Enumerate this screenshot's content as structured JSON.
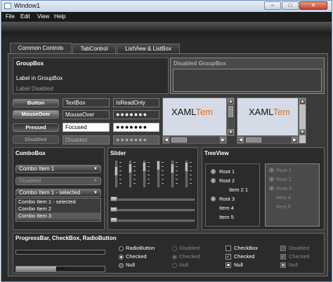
{
  "window": {
    "title": "Window1",
    "min": "–",
    "max": "□",
    "close": "✕"
  },
  "menu": [
    "File",
    "Edit",
    "View",
    "Help"
  ],
  "tabs": [
    "Common Controls",
    "TabControl",
    "ListView & ListBox"
  ],
  "groupbox": {
    "header": "GroupBox",
    "label": "Label in GroupBox",
    "label_disabled": "Label Disabled",
    "disabled_header": "Disabled GroupBox"
  },
  "buttons": [
    "Button",
    "MouseOver",
    "Pressed",
    "Disabled"
  ],
  "textboxes": [
    "TextBox",
    "MouseOver",
    "Focused",
    "Disabled"
  ],
  "passwords": {
    "readonly": "IsReadOnly",
    "p1": "●●●●●●●",
    "p2": "●●●●●●●",
    "p3": "●●●●●●●"
  },
  "xaml": {
    "prefix": "XAML",
    "suffix": "Tem"
  },
  "combobox": {
    "header": "ComboBox",
    "c1": "Combo Item 1",
    "c2": "Disabled",
    "c3": "Combo Item 1 - selected",
    "list": [
      "Combo Item 1 - selected",
      "Combo Item 2",
      "Combo Item 3"
    ]
  },
  "slider": {
    "header": "Slider"
  },
  "treeview": {
    "header": "TreeView",
    "items": [
      "Root 1",
      "Root 2",
      "Item 2 1",
      "Root 3",
      "Item 4",
      "Item 5"
    ],
    "dis_items": [
      "Root 1",
      "Root 2",
      "Root 3",
      "Item 4",
      "Item 5"
    ]
  },
  "progress": {
    "header": "ProgressBar, CheckBox, RadioButton",
    "value_label": "45%",
    "value": 0.45
  },
  "radios": {
    "col1": [
      "RadioButton",
      "Checked",
      "Null"
    ],
    "col2": [
      "Disabled",
      "Checked",
      "Null"
    ]
  },
  "checks": {
    "col1": [
      "CheckBox",
      "Checked",
      "Null"
    ],
    "col2": [
      "Disabled",
      "Checked",
      "Null"
    ]
  }
}
